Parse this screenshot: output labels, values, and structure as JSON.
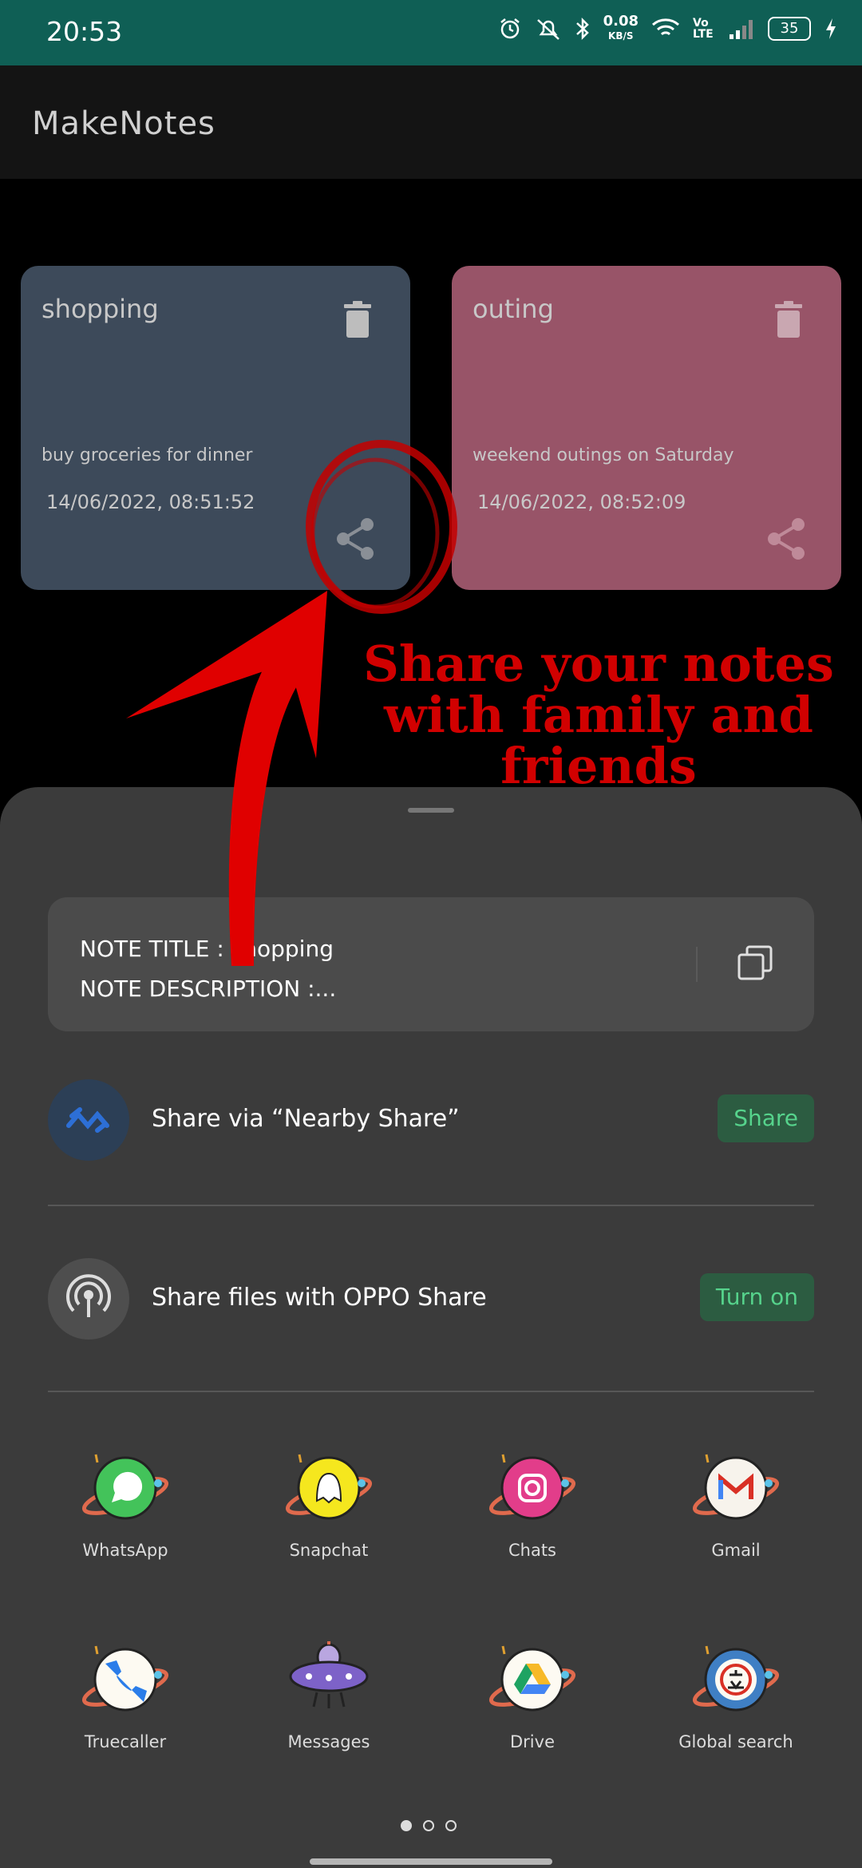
{
  "status_bar": {
    "time": "20:53",
    "speed_value": "0.08",
    "speed_unit": "KB/S",
    "volte": "Vo LTE",
    "battery": "35"
  },
  "app_bar": {
    "title": "MakeNotes"
  },
  "notes": [
    {
      "title": "shopping",
      "description": "buy groceries for dinner",
      "date": "14/06/2022, 08:51:52",
      "color": "#3d4a5a"
    },
    {
      "title": "outing",
      "description": "weekend outings on Saturday",
      "date": "14/06/2022, 08:52:09",
      "color": "#985468"
    }
  ],
  "annotation": {
    "line1": "Share your notes",
    "line2": "with family and",
    "line3": "friends",
    "color": "#d10000"
  },
  "share_sheet": {
    "note_title_line": "NOTE TITLE : shopping",
    "note_desc_line": "NOTE DESCRIPTION :...",
    "nearby": {
      "label": "Share via “Nearby Share”",
      "button": "Share"
    },
    "oppo": {
      "label": "Share files with OPPO Share",
      "button": "Turn on"
    },
    "apps": [
      {
        "label": "WhatsApp",
        "icon": "whatsapp-icon"
      },
      {
        "label": "Snapchat",
        "icon": "snapchat-icon"
      },
      {
        "label": "Chats",
        "icon": "chats-icon"
      },
      {
        "label": "Gmail",
        "icon": "gmail-icon"
      },
      {
        "label": "Truecaller",
        "icon": "truecaller-icon"
      },
      {
        "label": "Messages",
        "icon": "messages-icon"
      },
      {
        "label": "Drive",
        "icon": "drive-icon"
      },
      {
        "label": "Global search",
        "icon": "global-search-icon"
      }
    ],
    "accent_color": "#56d38c"
  }
}
